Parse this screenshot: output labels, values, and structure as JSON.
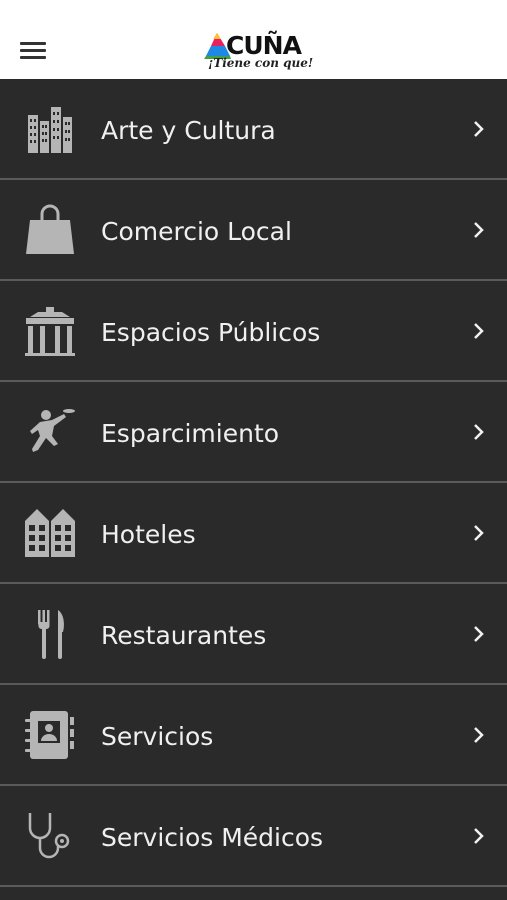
{
  "header": {
    "logo_text": "ACUÑA",
    "logo_tagline": "¡Tiene con que!",
    "menu_icon": "hamburger-menu-icon",
    "logo_colors": [
      "#e91e63",
      "#fbc02d",
      "#1e88e5",
      "#43a047"
    ]
  },
  "colors": {
    "background": "#2a2a2a",
    "divider": "#5a5a5a",
    "text": "#f0f0f0",
    "icon": "#b5b5b5"
  },
  "categories": [
    {
      "label": "Arte y Cultura",
      "icon": "buildings-icon"
    },
    {
      "label": "Comercio Local",
      "icon": "shopping-bag-icon"
    },
    {
      "label": "Espacios Públicos",
      "icon": "gate-monument-icon"
    },
    {
      "label": "Esparcimiento",
      "icon": "frisbee-player-icon"
    },
    {
      "label": "Hoteles",
      "icon": "hotel-icon"
    },
    {
      "label": "Restaurantes",
      "icon": "fork-knife-icon"
    },
    {
      "label": "Servicios",
      "icon": "contact-book-icon"
    },
    {
      "label": "Servicios Médicos",
      "icon": "stethoscope-icon"
    }
  ]
}
